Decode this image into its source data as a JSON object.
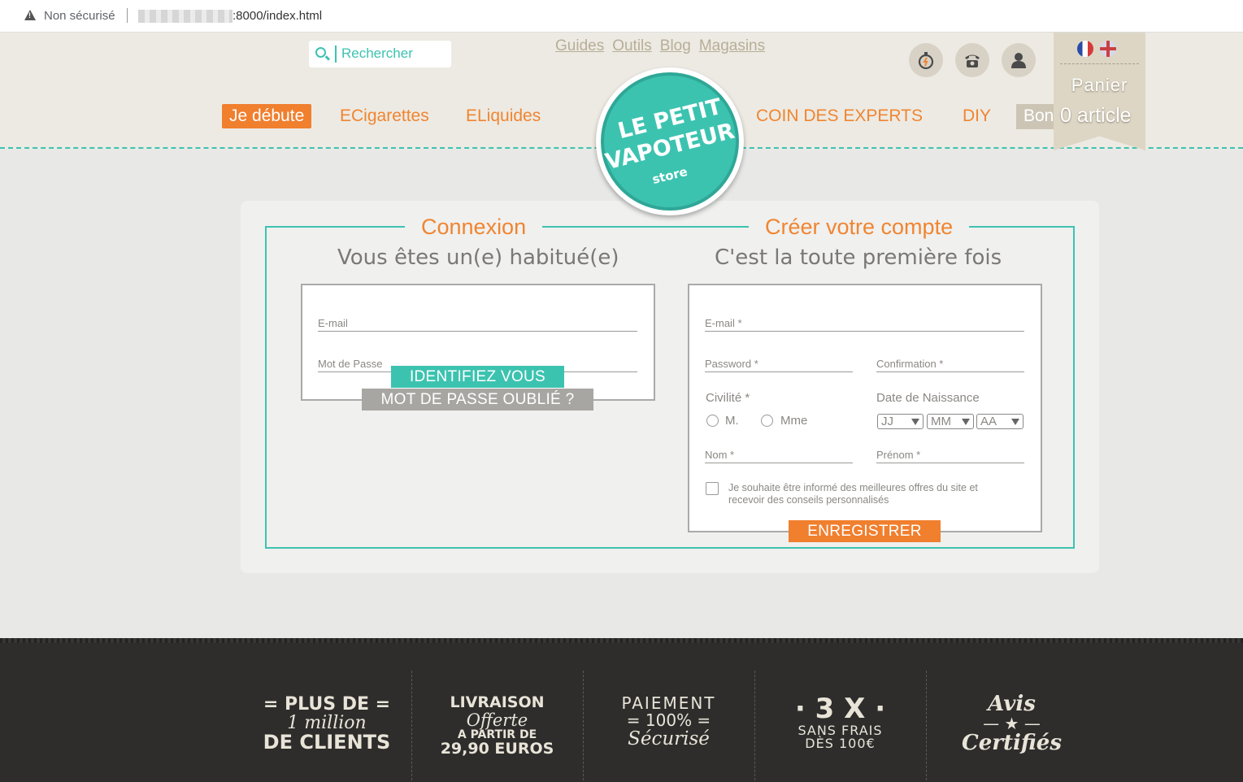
{
  "browser": {
    "security_label": "Non sécurisé",
    "url": ":8000/index.html"
  },
  "header": {
    "search_placeholder": "Rechercher",
    "top_links": [
      "Guides",
      "Outils",
      "Blog",
      "Magasins"
    ],
    "icons": [
      "stopwatch-icon",
      "phone-icon",
      "user-icon"
    ],
    "languages": [
      "fr-flag-icon",
      "uk-flag-icon"
    ],
    "cart": {
      "label": "Panier",
      "count": "0 article"
    },
    "menu_left": [
      "Je débute",
      "ECigarettes",
      "ELiquides"
    ],
    "menu_right": [
      "COIN DES EXPERTS",
      "DIY",
      "Bon"
    ],
    "logo": {
      "line1": "LE PETIT",
      "line2": "VAPOTEUR",
      "line3": "store"
    }
  },
  "login": {
    "title": "Connexion",
    "subtitle": "Vous êtes un(e) habitué(e)",
    "email_placeholder": "E-mail",
    "password_placeholder": "Mot de Passe",
    "submit_label": "IDENTIFIEZ VOUS",
    "forgot_label": "MOT DE PASSE OUBLIÉ ?"
  },
  "register": {
    "title": "Créer votre compte",
    "subtitle": "C'est la toute première fois",
    "email_placeholder": "E-mail *",
    "password_placeholder": "Password *",
    "confirm_placeholder": "Confirmation *",
    "civility_label": "Civilité *",
    "civility_options": [
      "M.",
      "Mme"
    ],
    "birthdate_label": "Date de Naissance",
    "day": "JJ",
    "month": "MM",
    "year": "AA",
    "lastname_placeholder": "Nom *",
    "firstname_placeholder": "Prénom *",
    "newsletter_text": "Je souhaite être informé des meilleures offres du site et recevoir des conseils personnalisés",
    "submit_label": "ENREGISTRER"
  },
  "footer": {
    "items": [
      {
        "lines": [
          "= PLUS DE =",
          "1 million",
          "DE CLIENTS"
        ]
      },
      {
        "lines": [
          "LIVRAISON",
          "Offerte",
          "A PARTIR DE",
          "29,90 EUROS"
        ]
      },
      {
        "lines": [
          "PAIEMENT",
          "= 100% =",
          "Sécurisé"
        ]
      },
      {
        "lines": [
          "· 3 X ·",
          "SANS FRAIS",
          "DÈS 100€"
        ]
      },
      {
        "lines": [
          "Avis",
          "— ★ —",
          "Certifiés"
        ]
      }
    ]
  },
  "colors": {
    "accent_teal": "#3cc3b0",
    "accent_orange": "#f07f2e",
    "header_bg": "#edeae3",
    "footer_bg": "#2e2d2c"
  }
}
